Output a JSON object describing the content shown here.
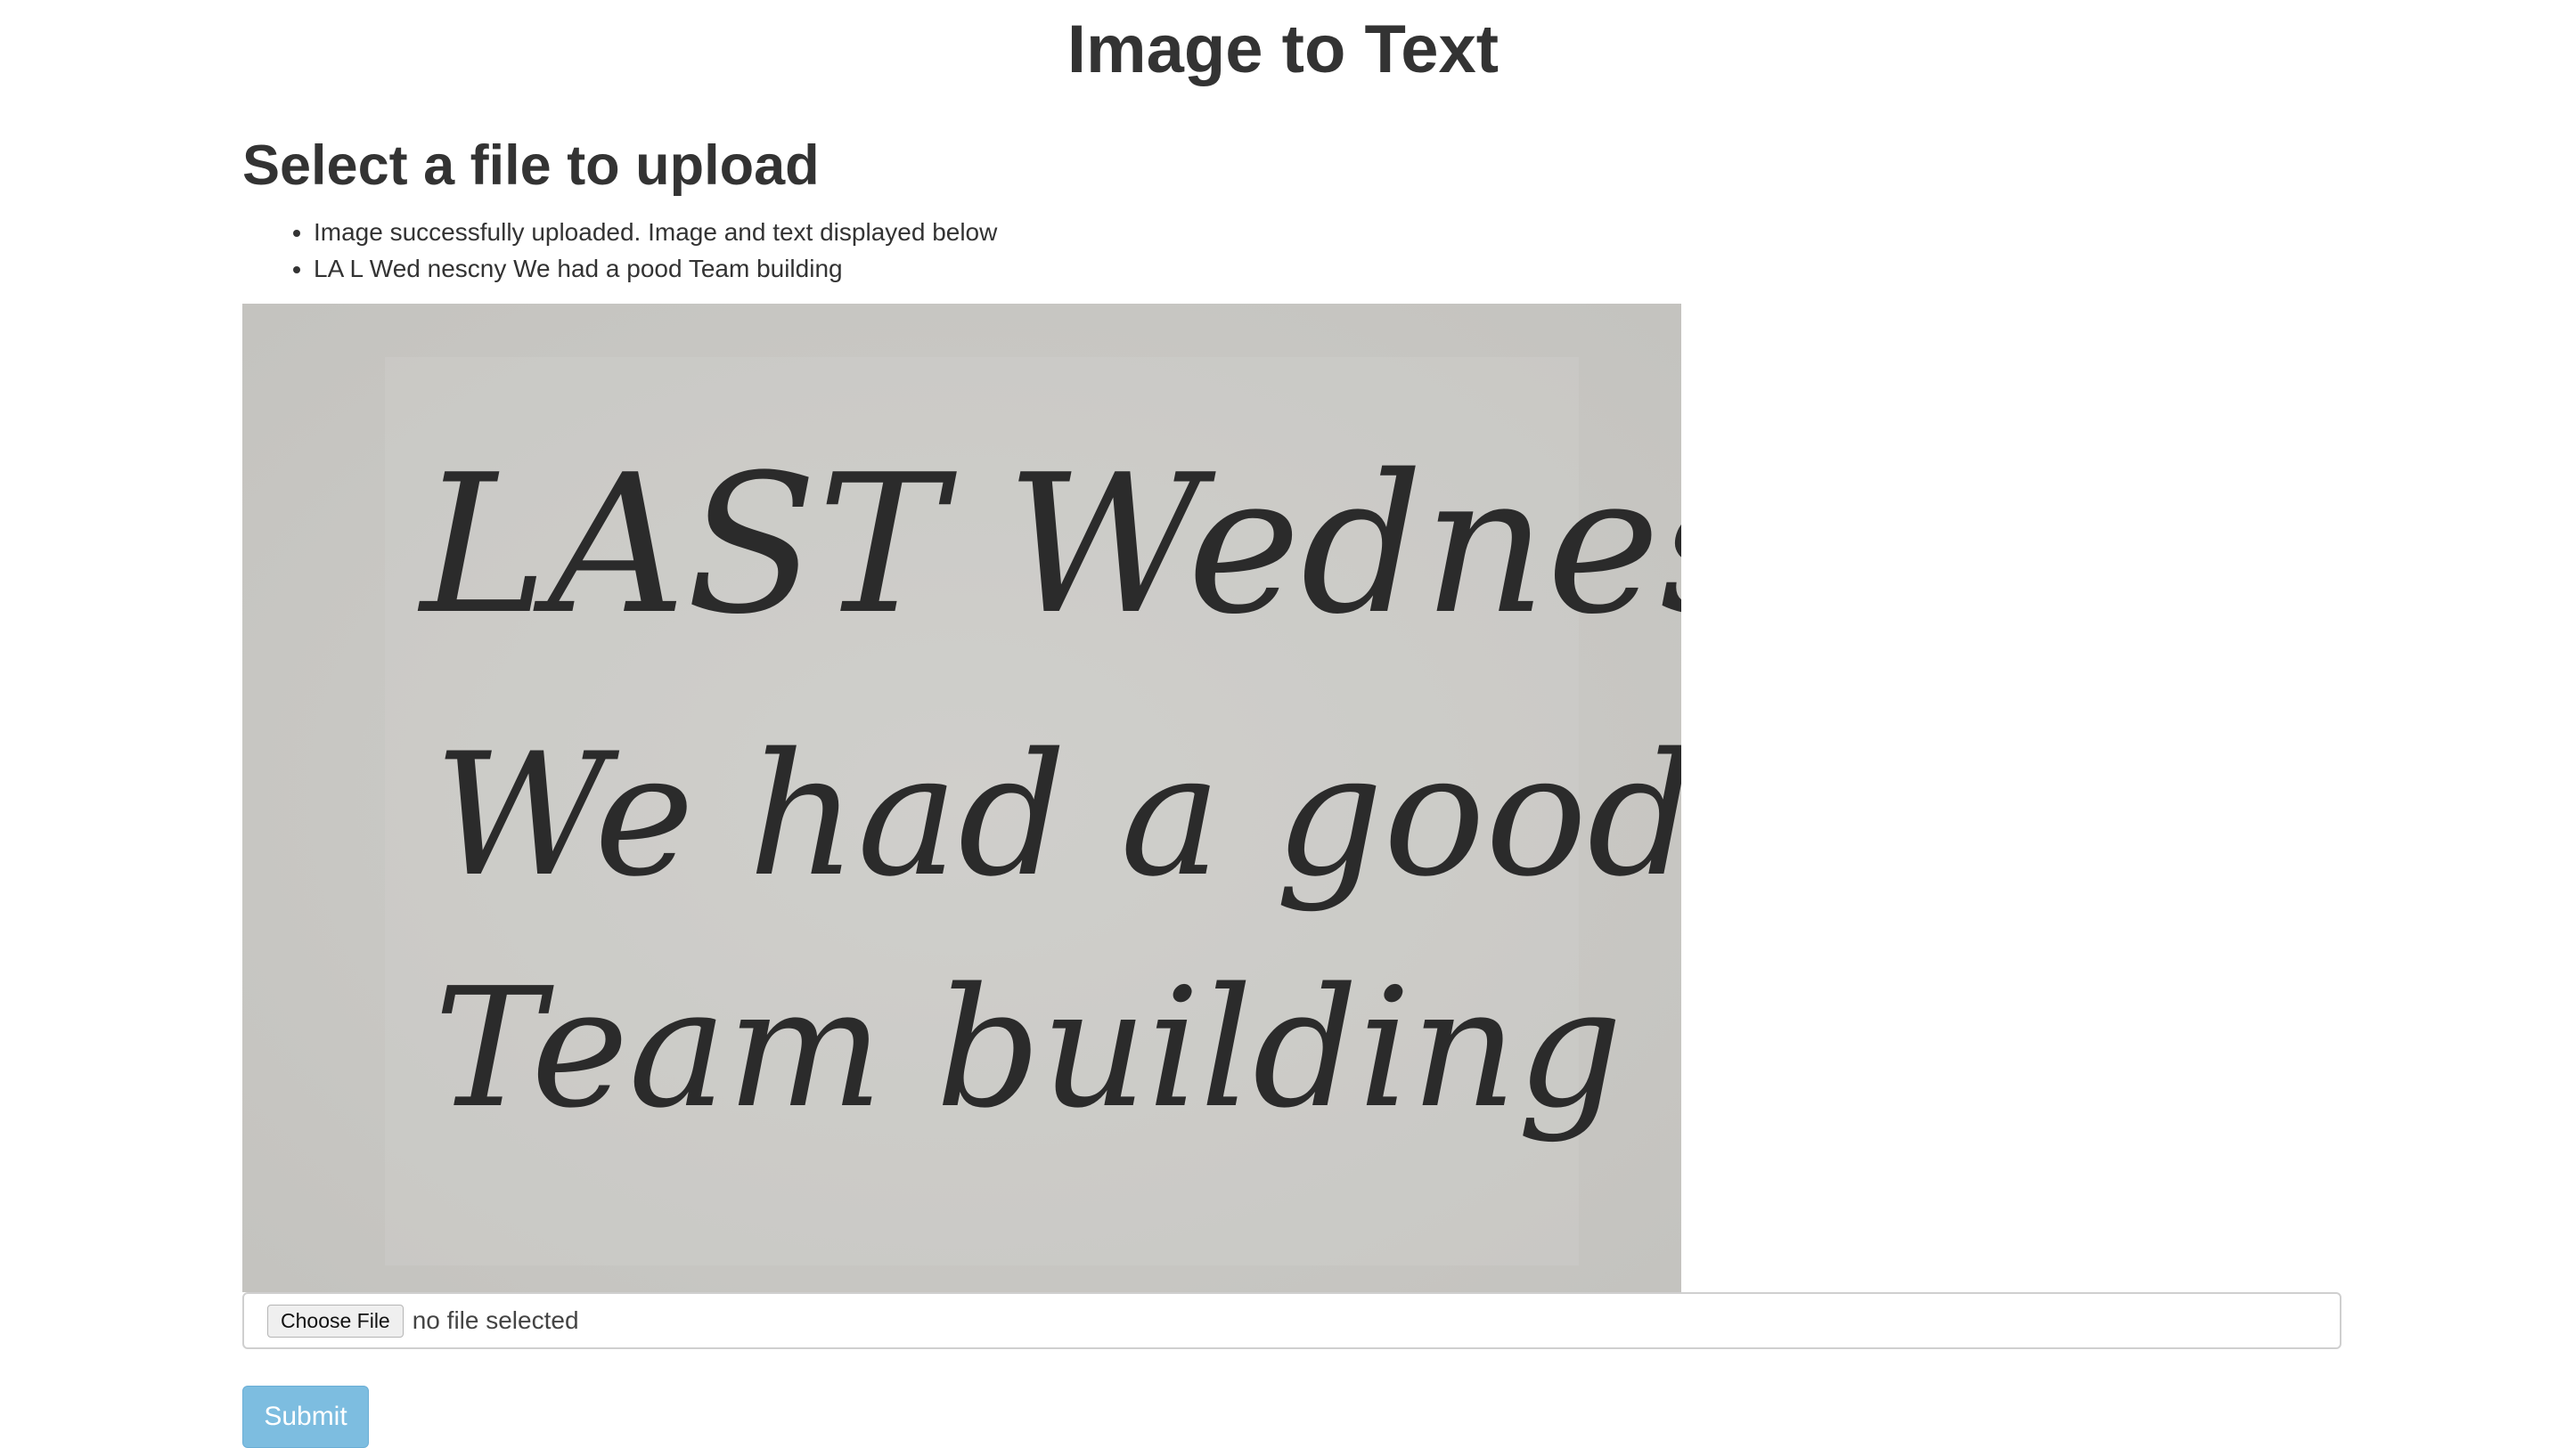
{
  "page": {
    "title": "Image to Text"
  },
  "upload": {
    "heading": "Select a file to upload",
    "messages": [
      "Image successfully uploaded. Image and text displayed below",
      "LA L Wed nescny We had a pood Team building"
    ],
    "uploaded_image": {
      "handwriting_lines": [
        "LAST Wednesday",
        "We had a good",
        "Team building"
      ]
    },
    "file_input": {
      "button_label": "Choose File",
      "status_text": "no file selected"
    },
    "submit_label": "Submit"
  },
  "colors": {
    "submit_background": "#7dbde0",
    "image_background": "#c9c8c4",
    "ink": "#2b2b2b"
  }
}
